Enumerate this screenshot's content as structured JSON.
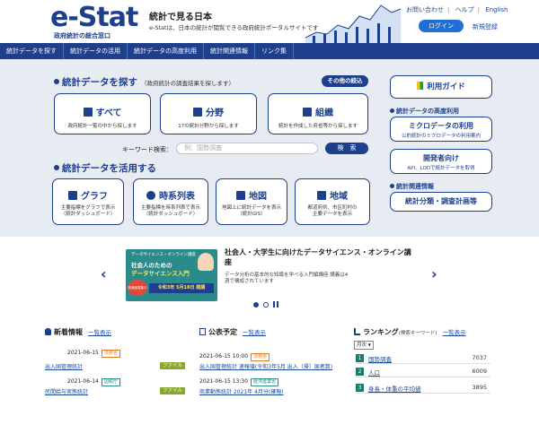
{
  "header": {
    "logo": "e-Stat",
    "logo_sub": "政府統計の総合窓口",
    "tagline_title": "統計で見る日本",
    "tagline_desc": "e-Statは、日本の統計が閲覧できる政府統計ポータルサイトです",
    "links": [
      "お問い合わせ",
      "ヘルプ",
      "English"
    ],
    "login_label": "ログイン",
    "register_label": "新規登録"
  },
  "nav": {
    "items": [
      "統計データを探す",
      "統計データの活用",
      "統計データの高度利用",
      "統計関連情報",
      "リンク集"
    ]
  },
  "search_section": {
    "title": "統計データを探す",
    "subtitle": "（政府統計の調査結果を探します）",
    "other_button": "その他の絞込",
    "cards": [
      {
        "title": "すべて",
        "desc": "政府統計一覧の中から探します"
      },
      {
        "title": "分野",
        "desc": "17の統計分野から探します"
      },
      {
        "title": "組織",
        "desc": "統計を作成した府省等から探します"
      }
    ],
    "keyword_label": "キーワード検索：",
    "keyword_placeholder": "例：国勢調査",
    "search_button": "検　索"
  },
  "use_section": {
    "title": "統計データを活用する",
    "cards": [
      {
        "title": "グラフ",
        "desc1": "主要指標をグラフで表示",
        "desc2": "（統計ダッシュボード）"
      },
      {
        "title": "時系列表",
        "desc1": "主要指標を時系列表で表示",
        "desc2": "（統計ダッシュボード）"
      },
      {
        "title": "地図",
        "desc1": "地図上に統計データを表示",
        "desc2": "（統計GIS）"
      },
      {
        "title": "地域",
        "desc1": "都道府県、市区町村の",
        "desc2": "主要データを表示"
      }
    ]
  },
  "right_column": {
    "guide_button": "利用ガイド",
    "advanced_title": "統計データの高度利用",
    "micro_title": "ミクロデータの利用",
    "micro_desc": "公的統計のミクロデータの利用案内",
    "dev_title": "開発者向け",
    "dev_desc": "API、LODで統計データを取得",
    "related_title": "統計関連情報",
    "survey_button": "統計分類・調査計画等"
  },
  "banner": {
    "image_line1": "データサイエンス・オンライン講座",
    "image_line2": "社会人のための",
    "image_line3": "データサイエンス入門",
    "image_badge": "令和3年 5月18日 開講",
    "image_left": "受講者募集中",
    "title": "社会人・大学生に向けたデータサイエンス・オンライン講座",
    "desc": "データ分析の基本的な知識を学べる入門編講座 講義は4週で構成されています",
    "prev": "‹",
    "next": "›"
  },
  "news": {
    "title": "新着情報",
    "list_link": "一覧表示",
    "items": [
      {
        "date": "2021-06-15",
        "tag": "法務省",
        "title": "出入国管理統計",
        "badge": "ファイル"
      },
      {
        "date": "2021-06-14",
        "tag": "国税庁",
        "title": "民間給与実態統計",
        "badge": "ファイル"
      }
    ]
  },
  "schedule": {
    "title": "公表予定",
    "list_link": "一覧表示",
    "items": [
      {
        "date": "2021-06-15 10:00",
        "tag": "法務省",
        "title": "出入国管理統計 速報値(令和3年5月 出入（帰）国者数)"
      },
      {
        "date": "2021-06-15 13:30",
        "tag": "経済産業省",
        "title": "商業動態統計 2021年 4月分(確報)"
      }
    ]
  },
  "ranking": {
    "title": "ランキング",
    "subtitle": "(検索キーワード)",
    "list_link": "一覧表示",
    "period": "月次",
    "items": [
      {
        "rank": "1",
        "name": "国勢調査",
        "count": "7037"
      },
      {
        "rank": "2",
        "name": "人口",
        "count": "6009"
      },
      {
        "rank": "3",
        "name": "身長・体重の平均値",
        "count": "3895"
      }
    ]
  },
  "colors": {
    "primary": "#1d3f8c",
    "accent": "#1f6fd6",
    "background": "#e7ecf3"
  }
}
